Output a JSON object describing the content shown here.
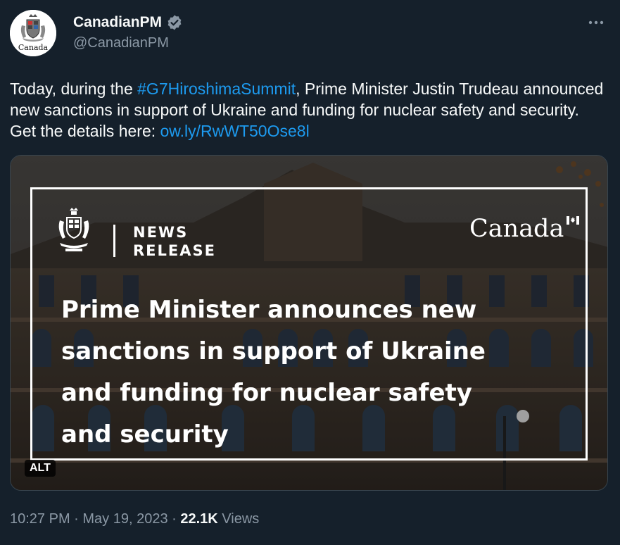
{
  "author": {
    "display_name": "CanadianPM",
    "handle": "@CanadianPM",
    "avatar_wordmark": "Canada",
    "verified_icon": "verified-badge-icon"
  },
  "tweet": {
    "text_before": "Today, during the ",
    "hashtag": "#G7HiroshimaSummit",
    "text_middle": ", Prime Minister Justin Trudeau announced new sanctions in support of Ukraine and funding for nuclear safety and security. Get the details here: ",
    "link": "ow.ly/RwWT50Ose8l"
  },
  "media": {
    "label_line1": "NEWS",
    "label_line2": "RELEASE",
    "wordmark": "Canada",
    "headline": "Prime Minister announces new sanctions in support of Ukraine and funding for nuclear safety and security",
    "alt_label": "ALT"
  },
  "meta": {
    "time": "10:27 PM",
    "sep1": " · ",
    "date": "May 19, 2023",
    "sep2": " · ",
    "views_count": "22.1K",
    "views_label": " Views"
  },
  "colors": {
    "background": "#15202b",
    "link": "#1d9bf0",
    "secondary_text": "#8b98a5",
    "verified": "#8b98a5"
  }
}
